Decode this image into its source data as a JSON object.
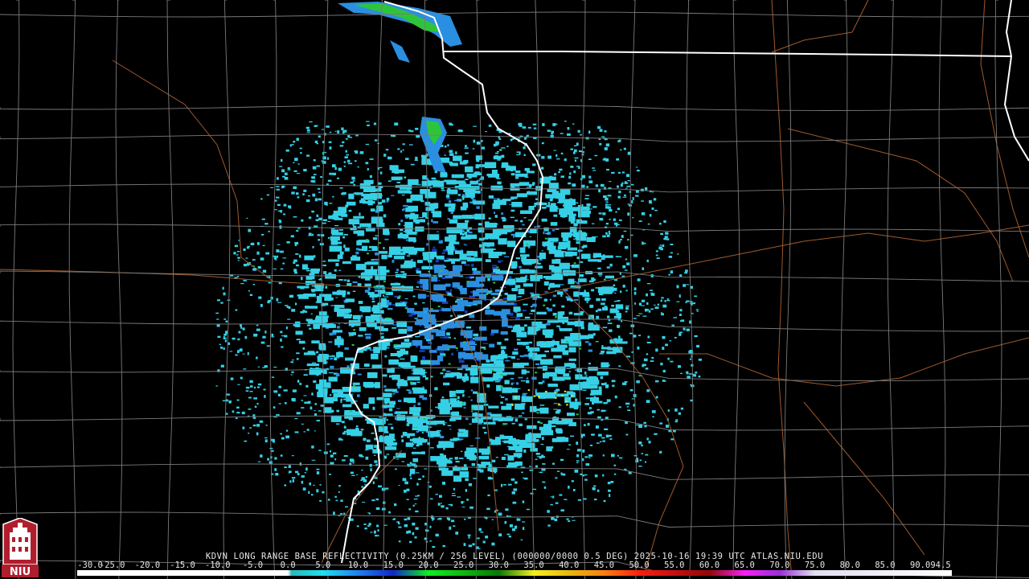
{
  "product": {
    "caption": "KDVN LONG RANGE BASE REFLECTIVITY (0.25KM / 256 LEVEL) (000000/0000 0.5 DEG) 2025-10-16 19:39 UTC  ATLAS.NIU.EDU"
  },
  "logo": {
    "text": "NIU"
  },
  "colors": {
    "background": "#000000",
    "county_lines": "#7a7a7a",
    "state_lines": "#ffffff",
    "highways": "#a05a2c",
    "echo_light": "#35d0e6",
    "echo_mid": "#2a8fe0",
    "echo_dark": "#1a3fbf",
    "echo_green": "#2ec43a",
    "echo_yellow": "#f2e01e",
    "logo_red": "#b01e2e"
  },
  "scale": {
    "labels": [
      "-30.0",
      "-25.0",
      "-20.0",
      "-15.0",
      "-10.0",
      "-5.0",
      "0.0",
      "5.0",
      "10.0",
      "15.0",
      "20.0",
      "25.0",
      "30.0",
      "35.0",
      "40.0",
      "45.0",
      "50.0",
      "55.0",
      "60.0",
      "65.0",
      "70.0",
      "75.0",
      "80.0",
      "85.0",
      "90.0",
      "94.5"
    ],
    "stops": [
      {
        "v": -30,
        "c": "#ffffff"
      },
      {
        "v": 0,
        "c": "#ffffff"
      },
      {
        "v": 0.5,
        "c": "#29b8b8"
      },
      {
        "v": 5,
        "c": "#20e0f0"
      },
      {
        "v": 10,
        "c": "#2080f0"
      },
      {
        "v": 15,
        "c": "#1028c8"
      },
      {
        "v": 20,
        "c": "#10f020"
      },
      {
        "v": 25,
        "c": "#10b810"
      },
      {
        "v": 30,
        "c": "#087808"
      },
      {
        "v": 35,
        "c": "#f8f020"
      },
      {
        "v": 40,
        "c": "#e8b810"
      },
      {
        "v": 45,
        "c": "#f88010"
      },
      {
        "v": 50,
        "c": "#f82010"
      },
      {
        "v": 55,
        "c": "#c81010"
      },
      {
        "v": 60,
        "c": "#900808"
      },
      {
        "v": 65,
        "c": "#f820f8"
      },
      {
        "v": 70,
        "c": "#9830d8"
      },
      {
        "v": 75,
        "c": "#e0e0f0"
      },
      {
        "v": 94.5,
        "c": "#ffffff"
      }
    ]
  }
}
